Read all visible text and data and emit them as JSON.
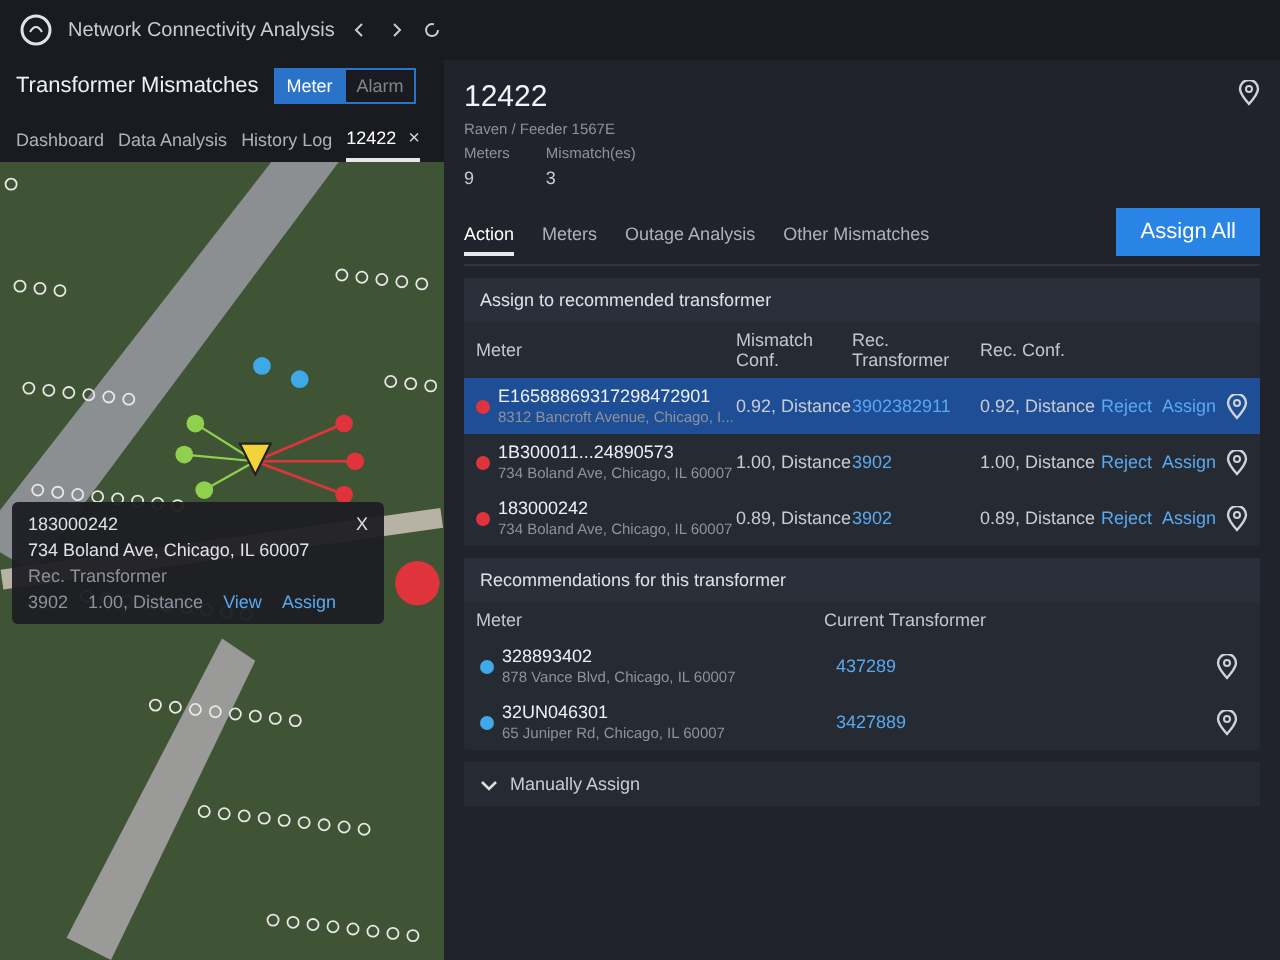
{
  "app": {
    "title": "Network Connectivity Analysis"
  },
  "page": {
    "title": "Transformer Mismatches",
    "toggle": [
      {
        "label": "Meter",
        "selected": true
      },
      {
        "label": "Alarm",
        "selected": false
      }
    ]
  },
  "tabs": [
    {
      "label": "Dashboard",
      "selected": false
    },
    {
      "label": "Data Analysis",
      "selected": false
    },
    {
      "label": "History Log",
      "selected": false
    },
    {
      "label": "12422",
      "selected": true,
      "close": "×"
    }
  ],
  "popup": {
    "meter": "183000242",
    "address": "734 Boland Ave, Chicago, IL 60007",
    "close": "X",
    "label": "Rec. Transformer",
    "transformer": "3902",
    "conf": "1.00, Distance",
    "links": [
      "View",
      "Assign"
    ]
  },
  "detail": {
    "id": "12422",
    "subtitle": "Raven / Feeder 1567E",
    "stats": [
      {
        "label": "Meters",
        "value": "9"
      },
      {
        "label": "Mismatch(es)",
        "value": "3"
      }
    ]
  },
  "detail_tabs": [
    {
      "label": "Action",
      "selected": true
    },
    {
      "label": "Meters",
      "selected": false
    },
    {
      "label": "Outage Analysis",
      "selected": false
    },
    {
      "label": "Other Mismatches",
      "selected": false
    }
  ],
  "assign_all": "Assign All",
  "assign_section": {
    "title": "Assign to recommended transformer",
    "columns": [
      "Meter",
      "Mismatch Conf.",
      "Rec. Transformer",
      "Rec. Conf."
    ],
    "rows": [
      {
        "meter": "E16588869317298472901",
        "address": "8312 Bancroft Avenue, Chicago, I...",
        "mismatch_conf": "0.92, Distance",
        "rec_transformer": "3902382911",
        "rec_conf": "0.92, Distance",
        "selected": true,
        "color": "#e0343c",
        "actions": [
          "Reject",
          "Assign"
        ]
      },
      {
        "meter": "1B300011...24890573",
        "address": "734 Boland Ave, Chicago, IL 60007",
        "mismatch_conf": "1.00, Distance",
        "rec_transformer": "3902",
        "rec_conf": "1.00, Distance",
        "selected": false,
        "color": "#e0343c",
        "actions": [
          "Reject",
          "Assign"
        ]
      },
      {
        "meter": "183000242",
        "address": "734 Boland Ave, Chicago, IL 60007",
        "mismatch_conf": "0.89, Distance",
        "rec_transformer": "3902",
        "rec_conf": "0.89, Distance",
        "selected": false,
        "color": "#e0343c",
        "actions": [
          "Reject",
          "Assign"
        ]
      }
    ]
  },
  "recommendations": {
    "title": "Recommendations for this transformer",
    "columns": [
      "Meter",
      "Current Transformer"
    ],
    "rows": [
      {
        "meter": "328893402",
        "address": "878 Vance Blvd, Chicago, IL 60007",
        "transformer": "437289",
        "color": "#3fa9e8"
      },
      {
        "meter": "32UN046301",
        "address": "65 Juniper Rd, Chicago, IL 60007",
        "transformer": "3427889",
        "color": "#3fa9e8"
      }
    ]
  },
  "manual": {
    "label": "Manually Assign"
  }
}
